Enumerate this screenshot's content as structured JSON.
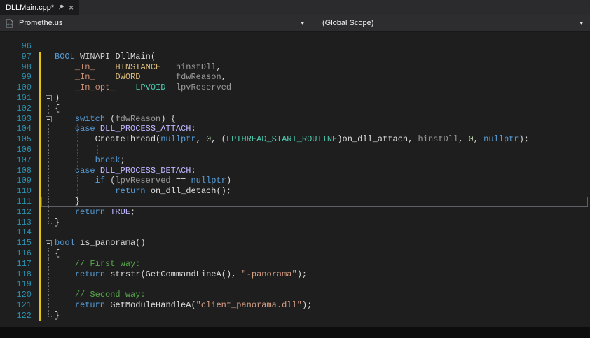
{
  "tab": {
    "title": "DLLMain.cpp*"
  },
  "navbar": {
    "project": "Promethe.us",
    "scope": "(Global Scope)"
  },
  "icons": {
    "chevron_down": "▾",
    "close": "×",
    "pin": "pin-icon",
    "project": "cpp-file-icon"
  },
  "ui_colors": {
    "editor_bg": "#1e1e1e",
    "tabbar_bg": "#2b2b2e",
    "tab_bg": "#1b1b1e",
    "navbar_bg": "#2d2d30",
    "line_number": "#2b91af",
    "change_bar": "#e2c50c",
    "current_line_border": "#5f5f66"
  },
  "palette": {
    "kw": "#569cd6",
    "ty": "#4ec9b0",
    "gold": "#d7ba7d",
    "mac": "#beb7ff",
    "sal": "#ce9178",
    "pl": "#dcdcdc",
    "wh": "#c8c8c8",
    "pr": "#9a9a9a",
    "nu": "#b5cea8",
    "st": "#d69d85",
    "co": "#57a64a"
  },
  "editor": {
    "lines": [
      {
        "n": 96,
        "chg": false,
        "tk": []
      },
      {
        "n": 97,
        "chg": true,
        "tk": [
          [
            "BOOL",
            "kw"
          ],
          [
            " ",
            "pl"
          ],
          [
            "WINAPI",
            "wh"
          ],
          [
            " ",
            "pl"
          ],
          [
            "DllMain",
            "pl"
          ],
          [
            "(",
            "pl"
          ]
        ]
      },
      {
        "n": 98,
        "chg": true,
        "tk": [
          [
            "    ",
            "pl"
          ],
          [
            "_In_",
            "sal"
          ],
          [
            "    ",
            "pl"
          ],
          [
            "HINSTANCE",
            "gold"
          ],
          [
            "   ",
            "pl"
          ],
          [
            "hinstDll",
            "pr"
          ],
          [
            ",",
            "pl"
          ]
        ]
      },
      {
        "n": 99,
        "chg": true,
        "tk": [
          [
            "    ",
            "pl"
          ],
          [
            "_In_",
            "sal"
          ],
          [
            "    ",
            "pl"
          ],
          [
            "DWORD",
            "gold"
          ],
          [
            "       ",
            "pl"
          ],
          [
            "fdwReason",
            "pr"
          ],
          [
            ",",
            "pl"
          ]
        ]
      },
      {
        "n": 100,
        "chg": true,
        "tk": [
          [
            "    ",
            "pl"
          ],
          [
            "_In_opt_",
            "sal"
          ],
          [
            "    ",
            "pl"
          ],
          [
            "LPVOID",
            "ty"
          ],
          [
            "  ",
            "pl"
          ],
          [
            "lpvReserved",
            "pr"
          ]
        ]
      },
      {
        "n": 101,
        "chg": true,
        "fold": "start",
        "tk": [
          [
            ")",
            "pl"
          ]
        ]
      },
      {
        "n": 102,
        "chg": true,
        "fold": "mid",
        "tk": [
          [
            "{",
            "pl"
          ]
        ]
      },
      {
        "n": 103,
        "chg": true,
        "fold": "start",
        "guides": [
          0
        ],
        "tk": [
          [
            "    ",
            "pl"
          ],
          [
            "switch",
            "kw"
          ],
          [
            " (",
            "pl"
          ],
          [
            "fdwReason",
            "pr"
          ],
          [
            ") {",
            "pl"
          ]
        ]
      },
      {
        "n": 104,
        "chg": true,
        "fold": "mid",
        "guides": [
          0,
          1
        ],
        "tk": [
          [
            "    ",
            "pl"
          ],
          [
            "case",
            "kw"
          ],
          [
            " ",
            "pl"
          ],
          [
            "DLL_PROCESS_ATTACH",
            "mac"
          ],
          [
            ":",
            "pl"
          ]
        ]
      },
      {
        "n": 105,
        "chg": true,
        "fold": "mid",
        "guides": [
          0,
          1
        ],
        "tk": [
          [
            "        ",
            "pl"
          ],
          [
            "CreateThread",
            "pl"
          ],
          [
            "(",
            "pl"
          ],
          [
            "nullptr",
            "kw"
          ],
          [
            ", ",
            "pl"
          ],
          [
            "0",
            "nu"
          ],
          [
            ", (",
            "pl"
          ],
          [
            "LPTHREAD_START_ROUTINE",
            "ty"
          ],
          [
            ")",
            "pl"
          ],
          [
            "on_dll_attach",
            "pl"
          ],
          [
            ", ",
            "pl"
          ],
          [
            "hinstDll",
            "pr"
          ],
          [
            ", ",
            "pl"
          ],
          [
            "0",
            "nu"
          ],
          [
            ", ",
            "pl"
          ],
          [
            "nullptr",
            "kw"
          ],
          [
            ");",
            "pl"
          ]
        ]
      },
      {
        "n": 106,
        "chg": true,
        "fold": "mid",
        "guides": [
          0,
          1,
          2
        ],
        "tk": []
      },
      {
        "n": 107,
        "chg": true,
        "fold": "mid",
        "guides": [
          0,
          1
        ],
        "tk": [
          [
            "        ",
            "pl"
          ],
          [
            "break",
            "kw"
          ],
          [
            ";",
            "pl"
          ]
        ]
      },
      {
        "n": 108,
        "chg": true,
        "fold": "mid",
        "guides": [
          0,
          1
        ],
        "tk": [
          [
            "    ",
            "pl"
          ],
          [
            "case",
            "kw"
          ],
          [
            " ",
            "pl"
          ],
          [
            "DLL_PROCESS_DETACH",
            "mac"
          ],
          [
            ":",
            "pl"
          ]
        ]
      },
      {
        "n": 109,
        "chg": true,
        "fold": "mid",
        "guides": [
          0,
          1
        ],
        "tk": [
          [
            "        ",
            "pl"
          ],
          [
            "if",
            "kw"
          ],
          [
            " (",
            "pl"
          ],
          [
            "lpvReserved",
            "pr"
          ],
          [
            " == ",
            "pl"
          ],
          [
            "nullptr",
            "kw"
          ],
          [
            ")",
            "pl"
          ]
        ]
      },
      {
        "n": 110,
        "chg": true,
        "fold": "mid",
        "guides": [
          0,
          1
        ],
        "tk": [
          [
            "            ",
            "pl"
          ],
          [
            "return",
            "kw"
          ],
          [
            " ",
            "pl"
          ],
          [
            "on_dll_detach",
            "pl"
          ],
          [
            "();",
            "pl"
          ]
        ]
      },
      {
        "n": 111,
        "chg": true,
        "fold": "mid",
        "cur": true,
        "guides": [
          0
        ],
        "tk": [
          [
            "    ",
            "pl"
          ],
          [
            "}",
            "pl"
          ]
        ]
      },
      {
        "n": 112,
        "chg": true,
        "fold": "mid",
        "guides": [
          0
        ],
        "tk": [
          [
            "    ",
            "pl"
          ],
          [
            "return",
            "kw"
          ],
          [
            " ",
            "pl"
          ],
          [
            "TRUE",
            "mac"
          ],
          [
            ";",
            "pl"
          ]
        ]
      },
      {
        "n": 113,
        "chg": true,
        "fold": "end",
        "tk": [
          [
            "}",
            "pl"
          ]
        ]
      },
      {
        "n": 114,
        "chg": true,
        "tk": []
      },
      {
        "n": 115,
        "chg": true,
        "fold": "start",
        "tk": [
          [
            "bool",
            "kw"
          ],
          [
            " ",
            "pl"
          ],
          [
            "is_panorama",
            "pl"
          ],
          [
            "()",
            "pl"
          ]
        ]
      },
      {
        "n": 116,
        "chg": true,
        "fold": "mid",
        "tk": [
          [
            "{",
            "pl"
          ]
        ]
      },
      {
        "n": 117,
        "chg": true,
        "fold": "mid",
        "guides": [
          0
        ],
        "tk": [
          [
            "    ",
            "pl"
          ],
          [
            "// First way:",
            "co"
          ]
        ]
      },
      {
        "n": 118,
        "chg": true,
        "fold": "mid",
        "guides": [
          0
        ],
        "tk": [
          [
            "    ",
            "pl"
          ],
          [
            "return",
            "kw"
          ],
          [
            " ",
            "pl"
          ],
          [
            "strstr",
            "pl"
          ],
          [
            "(",
            "pl"
          ],
          [
            "GetCommandLineA",
            "pl"
          ],
          [
            "(), ",
            "pl"
          ],
          [
            "\"-panorama\"",
            "st"
          ],
          [
            ");",
            "pl"
          ]
        ]
      },
      {
        "n": 119,
        "chg": true,
        "fold": "mid",
        "guides": [
          0
        ],
        "tk": []
      },
      {
        "n": 120,
        "chg": true,
        "fold": "mid",
        "guides": [
          0
        ],
        "tk": [
          [
            "    ",
            "pl"
          ],
          [
            "// Second way:",
            "co"
          ]
        ]
      },
      {
        "n": 121,
        "chg": true,
        "fold": "mid",
        "guides": [
          0
        ],
        "tk": [
          [
            "    ",
            "pl"
          ],
          [
            "return",
            "kw"
          ],
          [
            " ",
            "pl"
          ],
          [
            "GetModuleHandleA",
            "pl"
          ],
          [
            "(",
            "pl"
          ],
          [
            "\"client_panorama.dll\"",
            "st"
          ],
          [
            ");",
            "pl"
          ]
        ]
      },
      {
        "n": 122,
        "chg": true,
        "fold": "end",
        "tk": [
          [
            "}",
            "pl"
          ]
        ]
      }
    ]
  }
}
